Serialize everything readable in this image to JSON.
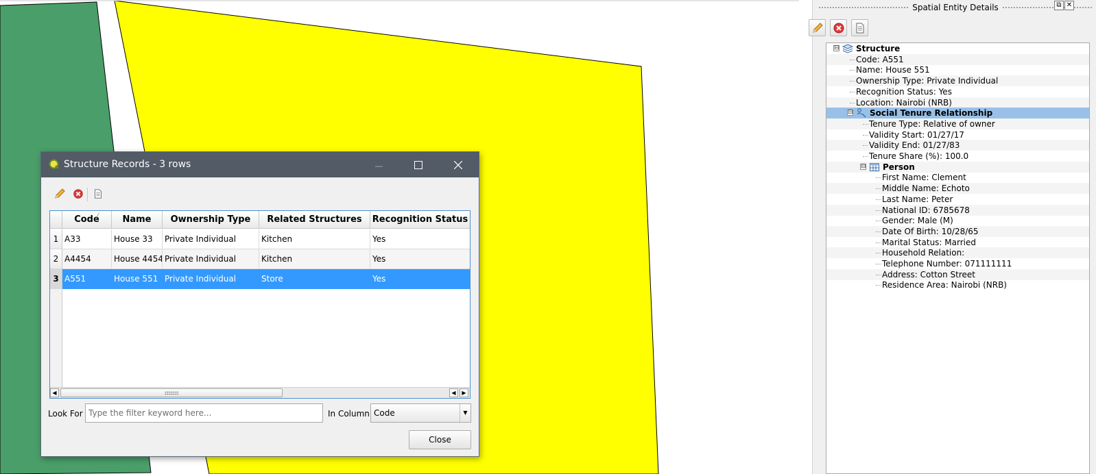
{
  "map": {
    "colors": {
      "green": "#4a9e69",
      "yellow": "#ffff00",
      "outline": "#000000"
    }
  },
  "dock": {
    "title": "Spatial Entity Details",
    "toolbar": {
      "edit_icon": "pencil-icon",
      "delete_icon": "remove-icon",
      "view_icon": "document-icon"
    },
    "tree": [
      {
        "text": "Structure",
        "level": 0,
        "bold": true,
        "icon": "layers-icon",
        "expander": "⊟"
      },
      {
        "text": "Code: A551",
        "level": 1
      },
      {
        "text": "Name: House 551",
        "level": 1
      },
      {
        "text": "Ownership Type: Private Individual",
        "level": 1
      },
      {
        "text": "Recognition Status: Yes",
        "level": 1
      },
      {
        "text": "Location: Nairobi (NRB)",
        "level": 1
      },
      {
        "text": "Social Tenure Relationship",
        "level": 1,
        "bold": true,
        "icon": "str-icon",
        "expander": "⊟",
        "selected": true
      },
      {
        "text": "Tenure Type: Relative of owner",
        "level": 2
      },
      {
        "text": "Validity Start: 01/27/17",
        "level": 2
      },
      {
        "text": "Validity End: 01/27/83",
        "level": 2
      },
      {
        "text": "Tenure Share (%): 100.0",
        "level": 2
      },
      {
        "text": "Person",
        "level": 2,
        "bold": true,
        "icon": "table-icon",
        "expander": "⊟"
      },
      {
        "text": "First Name: Clement",
        "level": 3
      },
      {
        "text": "Middle Name: Echoto",
        "level": 3
      },
      {
        "text": "Last Name: Peter",
        "level": 3
      },
      {
        "text": "National ID: 6785678",
        "level": 3
      },
      {
        "text": "Gender: Male (M)",
        "level": 3
      },
      {
        "text": "Date Of Birth: 10/28/65",
        "level": 3
      },
      {
        "text": "Marital Status: Married",
        "level": 3
      },
      {
        "text": "Household Relation:",
        "level": 3
      },
      {
        "text": "Telephone Number: 071111111",
        "level": 3
      },
      {
        "text": "Address: Cotton Street",
        "level": 3
      },
      {
        "text": "Residence Area: Nairobi (NRB)",
        "level": 3
      }
    ]
  },
  "dialog": {
    "title": "Structure Records - 3 rows",
    "columns": [
      "Code",
      "Name",
      "Ownership Type",
      "Related Structures",
      "Recognition Status"
    ],
    "sort_indicator": "╱",
    "rows": [
      {
        "num": "1",
        "cells": [
          "A33",
          "House 33",
          "Private Individual",
          "Kitchen",
          "Yes"
        ]
      },
      {
        "num": "2",
        "cells": [
          "A4454",
          "House 4454",
          "Private Individual",
          "Kitchen",
          "Yes"
        ]
      },
      {
        "num": "3",
        "cells": [
          "A551",
          "House 551",
          "Private Individual",
          "Store",
          "Yes"
        ],
        "selected": true
      }
    ],
    "look_for_label": "Look For",
    "filter_placeholder": "Type the filter keyword here...",
    "in_column_label": "In Column",
    "column_value": "Code",
    "close_label": "Close"
  }
}
